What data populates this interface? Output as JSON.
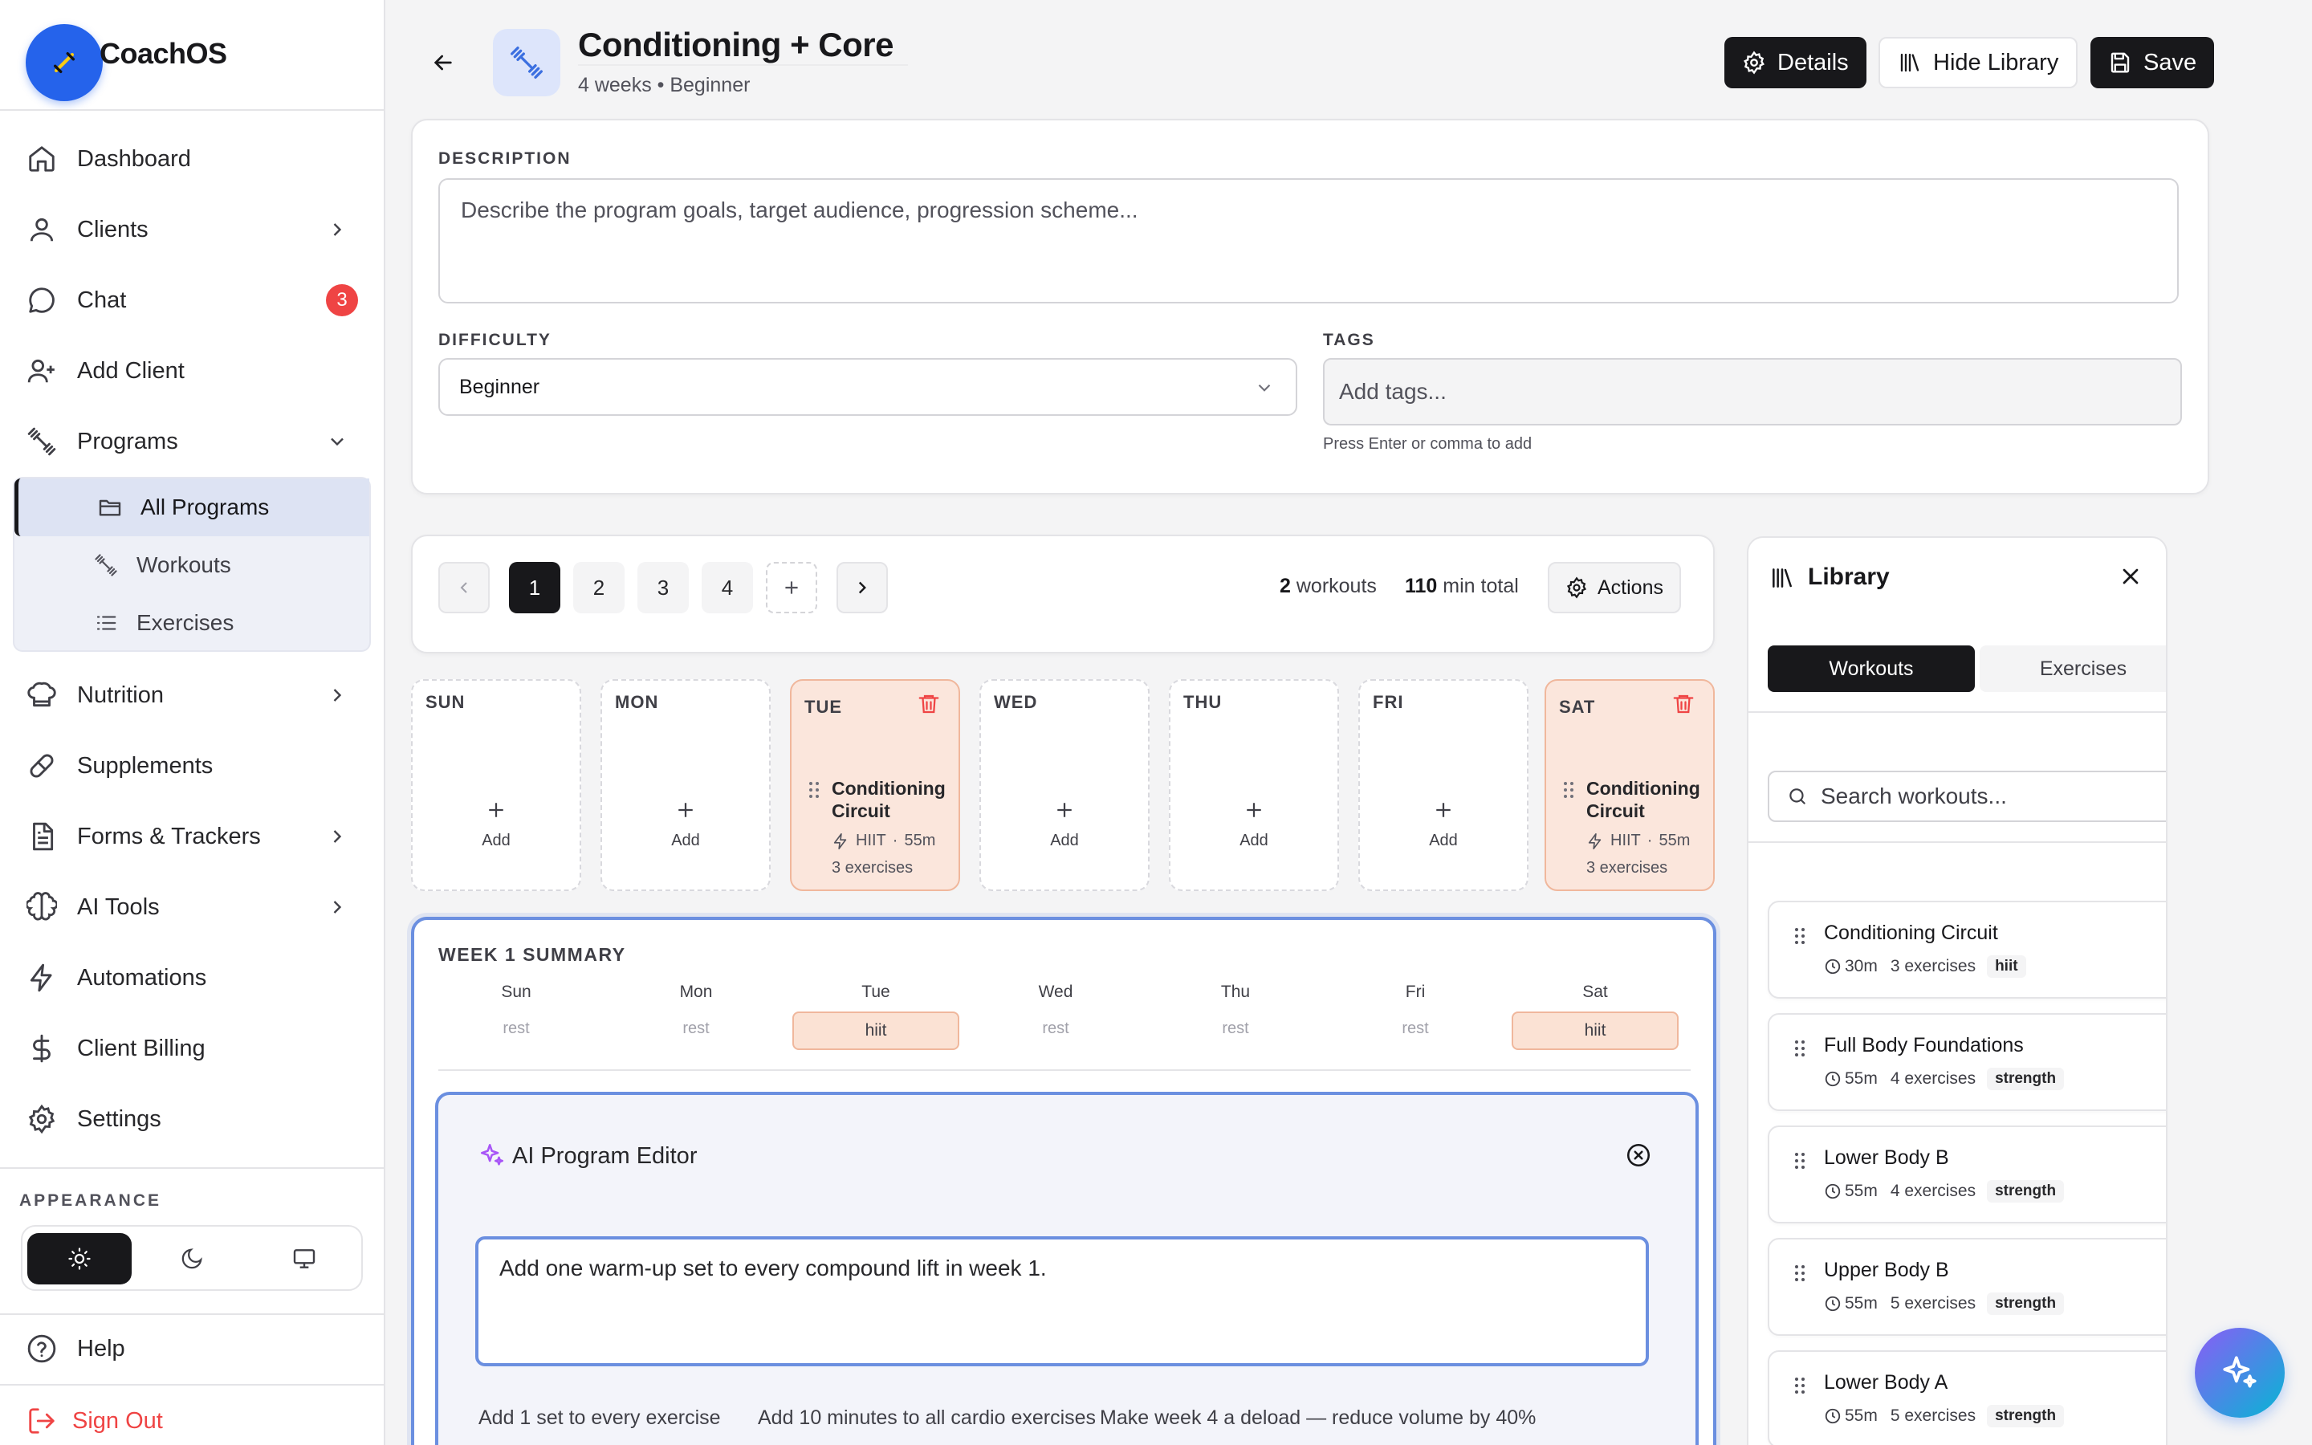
{
  "app": {
    "brand": "CoachOS"
  },
  "sidebar": {
    "nav": [
      {
        "label": "Dashboard",
        "icon": "home-icon"
      },
      {
        "label": "Clients",
        "icon": "user-icon"
      },
      {
        "label": "Chat",
        "icon": "chat-icon",
        "badge": "3"
      },
      {
        "label": "Add Client",
        "icon": "user-plus-icon"
      },
      {
        "label": "Programs",
        "icon": "dumbbell-icon"
      }
    ],
    "programs_sub": [
      {
        "label": "All Programs",
        "icon": "folder-icon",
        "active": true
      },
      {
        "label": "Workouts",
        "icon": "dumbbell-icon"
      },
      {
        "label": "Exercises",
        "icon": "list-icon"
      }
    ],
    "nav2": [
      {
        "label": "Nutrition",
        "icon": "chef-hat-icon"
      },
      {
        "label": "Supplements",
        "icon": "pill-icon"
      },
      {
        "label": "Forms & Trackers",
        "icon": "file-icon"
      },
      {
        "label": "AI Tools",
        "icon": "brain-icon"
      },
      {
        "label": "Automations",
        "icon": "zap-icon"
      },
      {
        "label": "Client Billing",
        "icon": "dollar-icon"
      },
      {
        "label": "Settings",
        "icon": "gear-icon"
      }
    ],
    "appearance_label": "APPEARANCE",
    "help": "Help",
    "sign_out": "Sign Out"
  },
  "header": {
    "title": "Conditioning + Core",
    "subtitle": "4 weeks • Beginner",
    "details": "Details",
    "hide_library": "Hide Library",
    "save": "Save"
  },
  "form": {
    "description_label": "DESCRIPTION",
    "description_placeholder": "Describe the program goals, target audience, progression scheme...",
    "difficulty_label": "DIFFICULTY",
    "difficulty_value": "Beginner",
    "tags_label": "TAGS",
    "tags_placeholder": "Add tags...",
    "tags_hint": "Press Enter or comma to add"
  },
  "weeks": {
    "pages": [
      "1",
      "2",
      "3",
      "4"
    ],
    "workouts_count": "2",
    "workouts_word": "workouts",
    "minutes_total": "110",
    "minutes_word": "min total",
    "actions": "Actions"
  },
  "days": [
    {
      "name": "SUN",
      "add": "Add"
    },
    {
      "name": "MON",
      "add": "Add"
    },
    {
      "name": "TUE",
      "workout": "Conditioning Circuit",
      "type": "HIIT",
      "duration": "55m",
      "exercises": "3 exercises"
    },
    {
      "name": "WED",
      "add": "Add"
    },
    {
      "name": "THU",
      "add": "Add"
    },
    {
      "name": "FRI",
      "add": "Add"
    },
    {
      "name": "SAT",
      "workout": "Conditioning Circuit",
      "type": "HIIT",
      "duration": "55m",
      "exercises": "3 exercises"
    }
  ],
  "summary": {
    "title": "WEEK 1 SUMMARY",
    "days": [
      {
        "day": "Sun",
        "status": "rest"
      },
      {
        "day": "Mon",
        "status": "rest"
      },
      {
        "day": "Tue",
        "status": "hiit"
      },
      {
        "day": "Wed",
        "status": "rest"
      },
      {
        "day": "Thu",
        "status": "rest"
      },
      {
        "day": "Fri",
        "status": "rest"
      },
      {
        "day": "Sat",
        "status": "hiit"
      }
    ]
  },
  "ai_editor": {
    "title": "AI Program Editor",
    "input": "Add one warm-up set to every compound lift in week 1.",
    "suggestions": [
      "Add 1 set to every exercise",
      "Add 10 minutes to all cardio exercises",
      "Make week 4 a deload — reduce volume by 40%"
    ]
  },
  "library": {
    "title": "Library",
    "tabs": [
      "Workouts",
      "Exercises"
    ],
    "search_placeholder": "Search workouts...",
    "items": [
      {
        "name": "Conditioning Circuit",
        "duration": "30m",
        "exercises": "3 exercises",
        "tag": "hiit"
      },
      {
        "name": "Full Body Foundations",
        "duration": "55m",
        "exercises": "4 exercises",
        "tag": "strength"
      },
      {
        "name": "Lower Body B",
        "duration": "55m",
        "exercises": "4 exercises",
        "tag": "strength"
      },
      {
        "name": "Upper Body B",
        "duration": "55m",
        "exercises": "5 exercises",
        "tag": "strength"
      },
      {
        "name": "Lower Body A",
        "duration": "55m",
        "exercises": "5 exercises",
        "tag": "strength"
      }
    ]
  },
  "colors": {
    "accent": "#2563eb",
    "danger": "#ef4444",
    "workout_bg": "#fbe6dc",
    "focus": "#6b8fe0"
  }
}
